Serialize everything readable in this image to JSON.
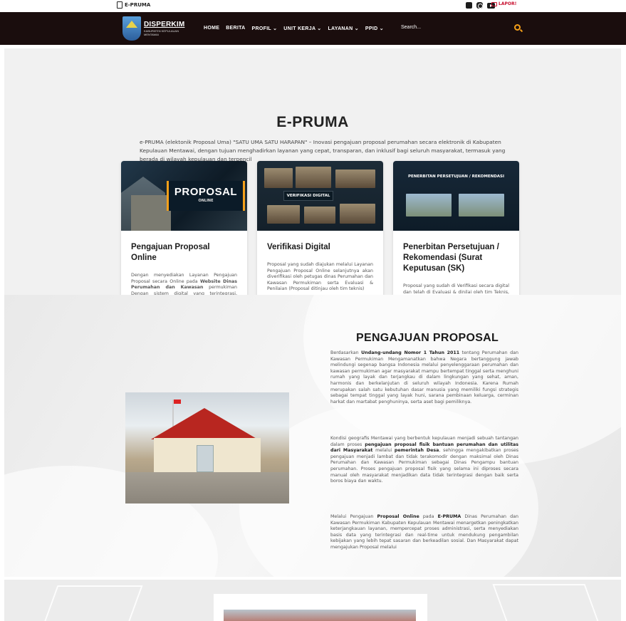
{
  "topbar": {
    "brand_tab": "E-PRUMA",
    "lapor_label": "LAPOR!"
  },
  "navbar": {
    "logo_title": "DISPERKIM",
    "logo_subtitle": "KABUPATEN KEPULAUAN MENTAWAI",
    "menu": [
      "HOME",
      "BERITA",
      "PROFIL ⌄",
      "UNIT KERJA ⌄",
      "LAYANAN ⌄",
      "PPID ⌄"
    ],
    "search_placeholder": "Search..."
  },
  "hero": {
    "title": "E-PRUMA",
    "description": "e-PRUMA (elektonik Proposal Uma) \"SATU UMA SATU HARAPAN\" – Inovasi pengajuan proposal perumahan secara elektronik di Kabupaten Kepulauan Mentawai, dengan tujuan menghadirkan layanan yang cepat, transparan, dan inklusif bagi seluruh masyarakat, termasuk yang berada di wilayah kepulauan dan terpencil"
  },
  "cards": [
    {
      "image_title": "PROPOSAL",
      "image_subtitle": "ONLINE",
      "title": "Pengajuan Proposal Online",
      "text_before": "Dengan menyediakan Layanan Pengajuan Proposal secara Online pada ",
      "text_bold": "Website Dinas Perumahan dan Kawasan",
      "text_after": " permukiman Dengan sistem digital yang terintegrasi, proses pengajuan proposal menjadi lebih efisien, terdokumentasi dengan baik, serta dapat dipantau melalui pelayanan secara digital."
    },
    {
      "image_title": "VERIFIKASI DIGITAL",
      "title": "Verifikasi Digital",
      "text": "Proposal yang sudah diajukan melalui Layanan Pengajuan Proposal Online selanjutnya akan diverifikasi oleh petugas dinas Perumahan dan Kawasan Permukiman serta Evaluasi & Penilaian (Proposal ditinjau oleh tim teknis)"
    },
    {
      "image_title": "PENERBITAN PERSETUJUAN / REKOMENDASI",
      "title": "Penerbitan Persetujuan / Rekomendasi (Surat Keputusan (SK)",
      "text": "Proposal yang sudah di Verifikasi secara digital dan telah di Evaluasi & dinilai oleh tim Teknis, selanjutnya akan diterbitkan Persetujuan / Rekomendasi (Surat Keputusan (SK) atau dokumen persetujuan keluar secara"
    }
  ],
  "section2": {
    "title": "PENGAJUAN PROPOSAL",
    "p1": {
      "a": "Berdasarkan ",
      "b": "Undang-undang Nomor 1 Tahun 2011",
      "c": " tentang Perumahan dan Kawasan Permukiman Mengamanatkan bahwa Negara bertanggung jawab melindungi segenap bangsa Indonesia melalui penyelenggaraan perumahan dan kawasan permukiman agar masyarakat mampu bertempat tinggal serta menghuni rumah yang layak dan terjangkau di dalam lingkungan yang sehat, aman, harmonis dan berkelanjutan di seluruh wilayah Indonesia. Karena Rumah merupakan salah satu kebutuhan dasar manusia yang memiliki fungsi strategis sebagai tempat tinggal yang layak huni, sarana pembinaan keluarga, cerminan harkat dan martabat penghuninya, serta aset bagi pemiliknya."
    },
    "p2": {
      "a": "Kondisi geografis Mentawai yang berbentuk kepulauan menjadi sebuah tantangan dalam proses ",
      "b": "pengajuan proposal fisik bantuan perumahan dan utilitas dari Masyarakat",
      "c": " melalui ",
      "d": "pemerintah Desa",
      "e": ", sehingga mengakibatkan proses pengajuan menjadi lambat dan tidak terakomodir dengan maksimal oleh Dinas Perumahan dan Kawasan Permukiman sebagai Dinas Pengampu bantuan perumahan. Proses pengajuan proposal fisik yang selama ini diproses secara manual oleh masyarakat menjadikan data tidak terintegrasi dengan baik serta boros biaya dan waktu."
    },
    "p3": {
      "a": "Melalui Pengajuan ",
      "b": "Proposal Online",
      "c": " pada ",
      "d": "E-PRUMA",
      "e": " Dinas Perumahan dan Kawasan Permukiman Kabupaten Kepulauan Mentawai menargetkan peningkatkan keterjangkauan layanan, mempercepat proses administrasi, serta menyediakan basis data yang terintegrasi dan real-time untuk mendukung pengambilan kebijakan yang lebih tepat sasaran dan berkeadilan sosial. Dan Masyarakat dapat mengajukan Proposal melalui"
    }
  }
}
